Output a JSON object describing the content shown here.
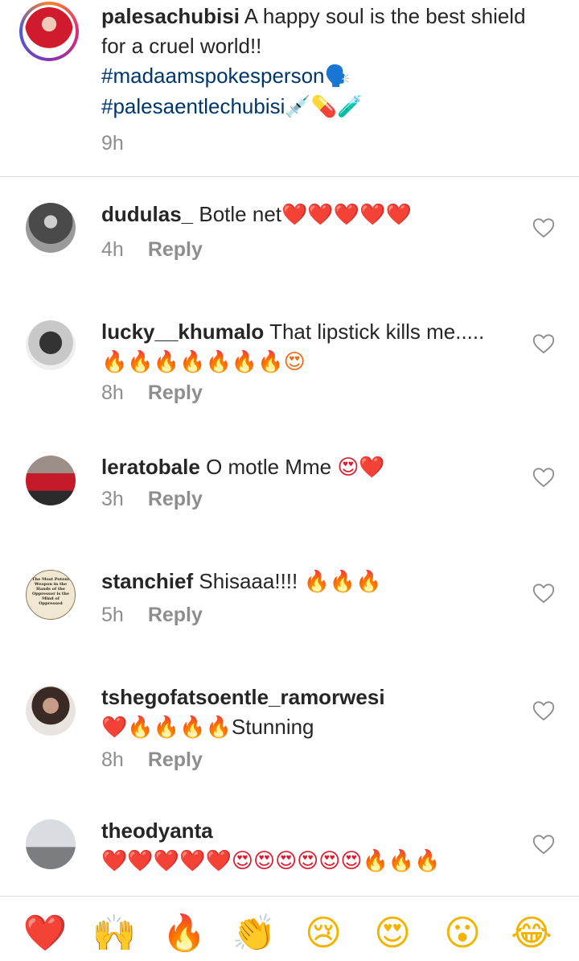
{
  "caption": {
    "username": "palesachubisi",
    "text": "A happy soul is the best shield for a cruel world!!",
    "hashtag1": "#madaamspokesperson",
    "hashtag1_emoji": "🗣️",
    "hashtag2": "#palesaentlechubisi",
    "hashtag2_emoji": "💉💊🧪",
    "time": "9h"
  },
  "comments": [
    {
      "username": "dudulas_",
      "text": "Botle net",
      "emoji": "❤️❤️❤️❤️❤️",
      "time": "4h",
      "reply": "Reply"
    },
    {
      "username": "lucky__khumalo",
      "text": "That lipstick kills me.....",
      "emoji": "🔥🔥🔥🔥🔥🔥🔥😍",
      "time": "8h",
      "reply": "Reply"
    },
    {
      "username": "leratobale",
      "text": "O motle Mme",
      "emoji": "😍❤️",
      "time": "3h",
      "reply": "Reply"
    },
    {
      "username": "stanchief",
      "text": "Shisaaa!!!!",
      "emoji": "🔥🔥🔥",
      "time": "5h",
      "reply": "Reply",
      "avatar_text": "The Most Potent Weapon in the Hands of the Oppressor is the Mind of Oppressed"
    },
    {
      "username": "tshegofatsoentle_ramorwesi",
      "emoji_before": "❤️🔥🔥🔥🔥",
      "text": "Stunning",
      "time": "8h",
      "reply": "Reply"
    },
    {
      "username": "theodyanta",
      "emoji": "❤️❤️❤️❤️❤️😍😍😍😍😍😍🔥🔥🔥"
    }
  ],
  "reactions": [
    "❤️",
    "🙌",
    "🔥",
    "👏",
    "😢",
    "😍",
    "😮",
    "😂"
  ],
  "colors": {
    "hashtag": "#00376b",
    "muted": "#8e8e8e",
    "divider": "#dbdbdb"
  }
}
